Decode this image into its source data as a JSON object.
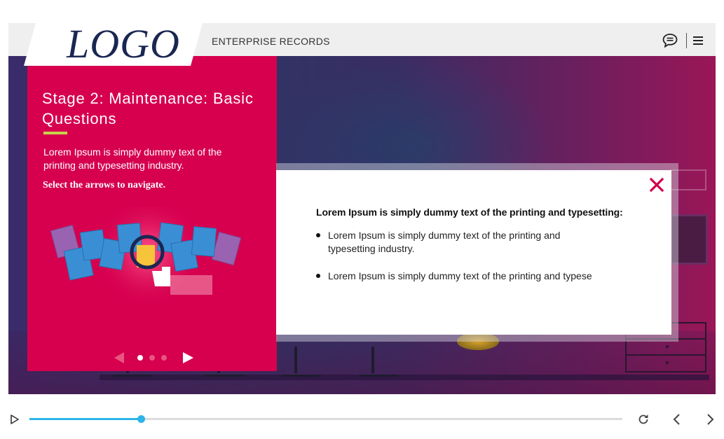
{
  "header": {
    "logo_text": "LOGO",
    "course_title": "ENTERPRISE RECORDS",
    "icons": [
      "chat-icon",
      "hamburger-menu-icon"
    ]
  },
  "left_panel": {
    "title": "Stage 2: Maintenance: Basic Questions",
    "body": "Lorem Ipsum is simply dummy text of the printing and typesetting industry.",
    "instruction": "Select the arrows to navigate.",
    "pager": {
      "current": 1,
      "total": 3
    },
    "icons": [
      "prev-arrow-icon",
      "next-arrow-icon",
      "documents-magnifier-illustration"
    ]
  },
  "popup": {
    "heading": "Lorem Ipsum is simply dummy text of the printing and typesetting:",
    "bullets": [
      "Lorem Ipsum is simply dummy text of the printing and typesetting industry.",
      "Lorem Ipsum is simply dummy text of the printing and typese"
    ],
    "close_icon": "close-icon"
  },
  "playbar": {
    "progress": 0.188,
    "icons": [
      "play-icon",
      "replay-icon",
      "prev-icon",
      "next-icon"
    ]
  },
  "colors": {
    "accent": "#d6004f",
    "progress": "#2db4e8",
    "logo": "#1a2752",
    "underline": "#c7d34a"
  }
}
